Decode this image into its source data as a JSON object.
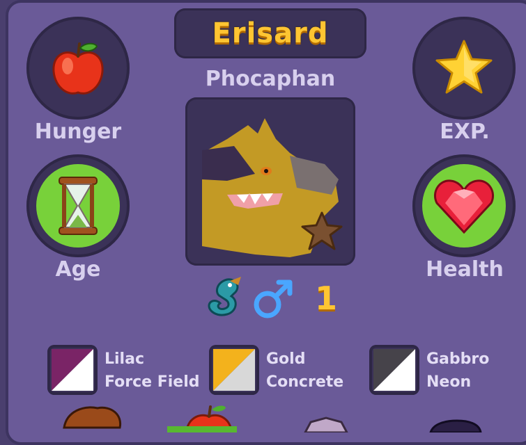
{
  "pet": {
    "name": "Erisard",
    "species": "Phocaphan",
    "level": "1",
    "gender_icon": "male-symbol-icon",
    "type_icon": "sea-dragon-icon",
    "portrait_icon": "pet-portrait-icon",
    "rarity_icon": "bronze-star-icon"
  },
  "stats": {
    "hunger": {
      "label": "Hunger",
      "icon": "apple-icon"
    },
    "exp": {
      "label": "EXP.",
      "icon": "star-icon"
    },
    "age": {
      "label": "Age",
      "icon": "hourglass-icon"
    },
    "health": {
      "label": "Health",
      "icon": "heart-gem-icon"
    }
  },
  "colors": [
    {
      "line1": "Lilac",
      "line2": "Force Field",
      "primary": "#7a2466",
      "secondary": "#ffffff"
    },
    {
      "line1": "Gold",
      "line2": "Concrete",
      "primary": "#f3b21c",
      "secondary": "#d8d8d8"
    },
    {
      "line1": "Gabbro",
      "line2": "Neon",
      "primary": "#46434a",
      "secondary": "#ffffff"
    }
  ],
  "theme": {
    "panel": "#6a5a98",
    "plate": "#3b3258",
    "title": "#ffc532",
    "label": "#d8d0ee",
    "stat_green": "#78d13a"
  }
}
